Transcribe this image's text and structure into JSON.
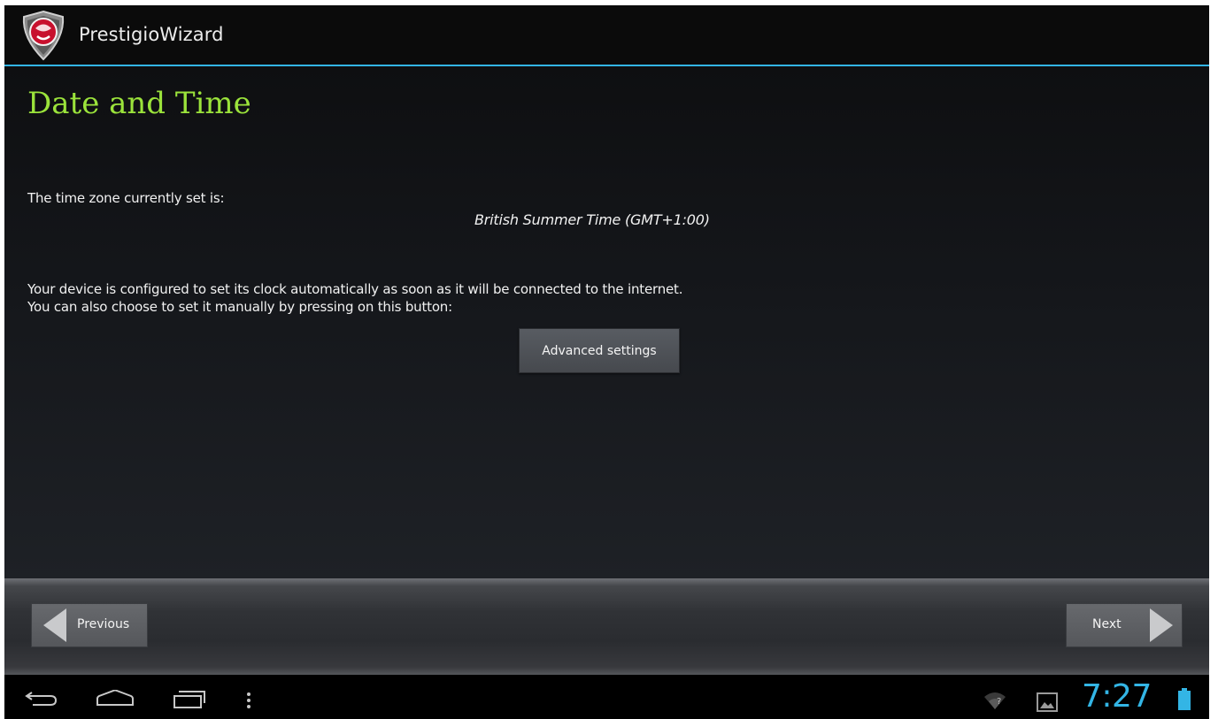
{
  "action_bar": {
    "app_title": "PrestigioWizard",
    "logo_icon": "prestigio-shield-logo-icon"
  },
  "content": {
    "page_title": "Date and Time",
    "timezone_label": "The time zone currently set is:",
    "timezone_value": "British Summer Time (GMT+1:00)",
    "description_line1": "Your device is configured to set its clock automatically as soon as it will be connected to the internet.",
    "description_line2": "You can also choose to set it manually by pressing on this button:",
    "advanced_button_label": "Advanced settings"
  },
  "navigation": {
    "previous_label": "Previous",
    "next_label": "Next"
  },
  "system_bar": {
    "clock": "7:27",
    "icons": [
      "back-icon",
      "home-icon",
      "recents-icon",
      "menu-icon",
      "wifi-icon",
      "notification-image-icon",
      "battery-icon"
    ]
  },
  "colors": {
    "accent_blue": "#33b5e5",
    "title_green": "#9be33b"
  }
}
